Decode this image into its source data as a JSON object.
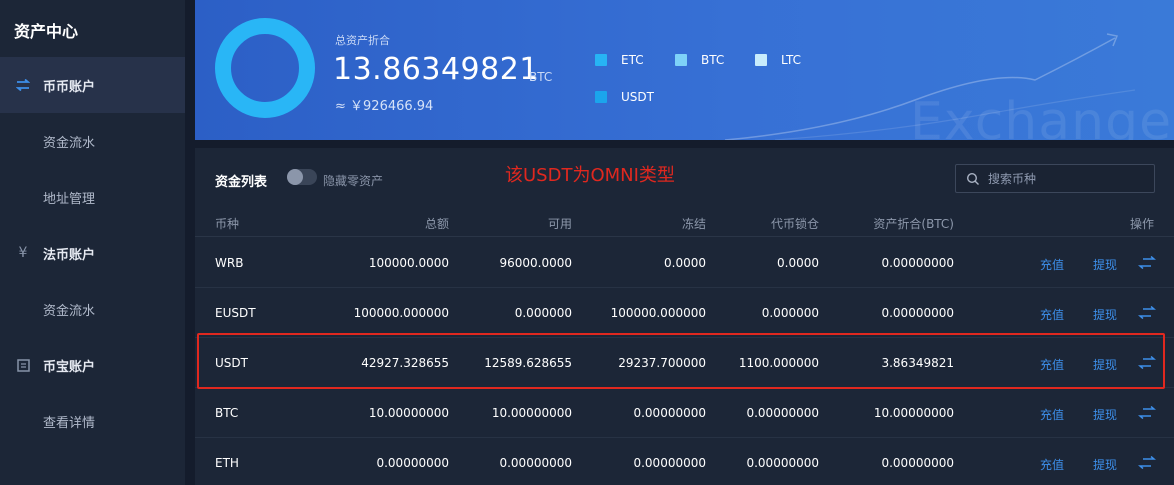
{
  "sidebar": {
    "title": "资产中心",
    "sections": [
      {
        "label": "币币账户",
        "icon": "swap-arrows-icon",
        "active": true
      },
      {
        "label": "资金流水",
        "sub": true
      },
      {
        "label": "地址管理",
        "sub": true
      },
      {
        "label": "法币账户",
        "icon": "yen-icon"
      },
      {
        "label": "资金流水",
        "sub": true
      },
      {
        "label": "币宝账户",
        "icon": "wallet-icon"
      },
      {
        "label": "查看详情",
        "sub": true
      }
    ]
  },
  "summary": {
    "label": "总资产折合",
    "value": "13.86349821",
    "unit": "BTC",
    "cny": "≈ ￥926466.94",
    "legend": [
      {
        "name": "ETC",
        "color": "#27b4f4"
      },
      {
        "name": "BTC",
        "color": "#7ed2f8"
      },
      {
        "name": "LTC",
        "color": "#c8ecfc"
      },
      {
        "name": "USDT",
        "color": "#1ba5ec"
      }
    ],
    "watermark": "Exchange",
    "donut_color": "#29b6f6"
  },
  "panel": {
    "title": "资金列表",
    "toggle_label": "隐藏零资产",
    "note": "该USDT为OMNI类型",
    "search_placeholder": "搜索币种",
    "columns": [
      "币种",
      "总额",
      "可用",
      "冻结",
      "代币锁仓",
      "资产折合(BTC)",
      "操作"
    ],
    "deposit_label": "充值",
    "withdraw_label": "提现",
    "rows": [
      {
        "coin": "WRB",
        "total": "100000.0000",
        "available": "96000.0000",
        "frozen": "0.0000",
        "locked": "0.0000",
        "btc": "0.00000000"
      },
      {
        "coin": "EUSDT",
        "total": "100000.000000",
        "available": "0.000000",
        "frozen": "100000.000000",
        "locked": "0.000000",
        "btc": "0.00000000"
      },
      {
        "coin": "USDT",
        "total": "42927.328655",
        "available": "12589.628655",
        "frozen": "29237.700000",
        "locked": "1100.000000",
        "btc": "3.86349821"
      },
      {
        "coin": "BTC",
        "total": "10.00000000",
        "available": "10.00000000",
        "frozen": "0.00000000",
        "locked": "0.00000000",
        "btc": "10.00000000"
      },
      {
        "coin": "ETH",
        "total": "0.00000000",
        "available": "0.00000000",
        "frozen": "0.00000000",
        "locked": "0.00000000",
        "btc": "0.00000000"
      }
    ]
  },
  "colors": {
    "accent": "#3d8fea",
    "highlight": "#e0281f"
  }
}
